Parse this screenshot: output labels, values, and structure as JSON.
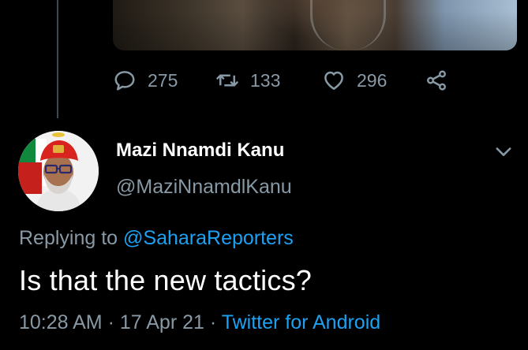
{
  "prev_tweet": {
    "reply_count": "275",
    "retweet_count": "133",
    "like_count": "296"
  },
  "reply_tweet": {
    "author_name": "Mazi Nnamdi Kanu",
    "author_handle": "@MaziNnamdlKanu",
    "replying_prefix": "Replying to",
    "replying_to": "@SaharaReporters",
    "text": "Is that the new tactics?",
    "time": "10:28 AM",
    "date": "17 Apr 21",
    "separator": "·",
    "source": "Twitter for Android"
  },
  "icons": {
    "reply": "reply-icon",
    "retweet": "retweet-icon",
    "like": "heart-icon",
    "share": "share-icon",
    "more": "chevron-down-icon"
  },
  "colors": {
    "background": "#000000",
    "secondary_text": "#8899a6",
    "link": "#1da1f2",
    "thread_line": "#3d4a55"
  }
}
